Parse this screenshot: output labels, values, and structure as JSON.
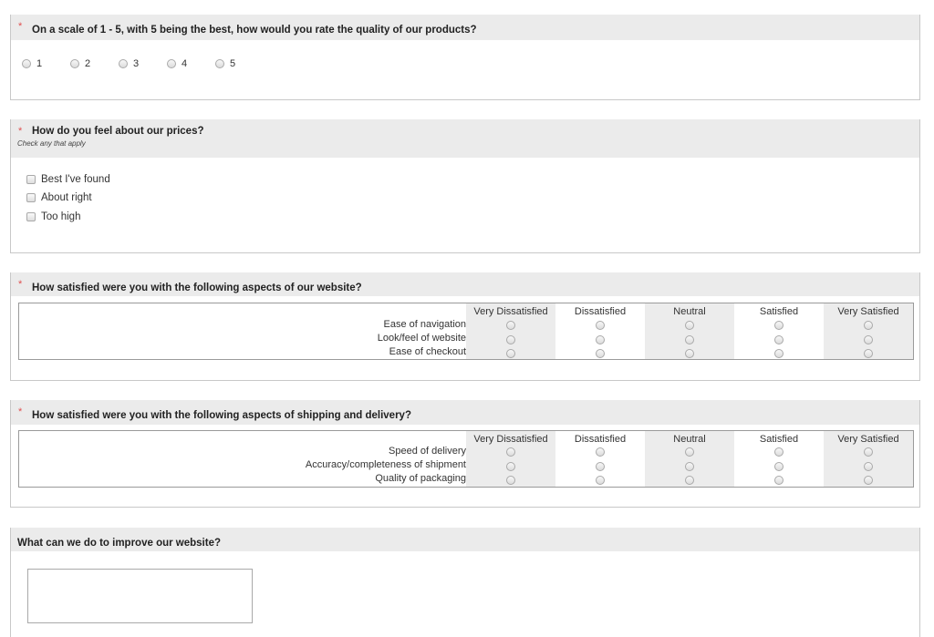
{
  "q1": {
    "required_mark": "*",
    "title": "On a scale of 1 - 5, with 5 being the best, how would you rate the quality of our products?",
    "options": [
      "1",
      "2",
      "3",
      "4",
      "5"
    ]
  },
  "q2": {
    "required_mark": "*",
    "title": "How do you feel about our prices?",
    "subtitle": "Check any that apply",
    "options": [
      "Best I've found",
      "About right",
      "Too high"
    ]
  },
  "q3": {
    "required_mark": "*",
    "title": "How satisfied were you with the following aspects of our website?",
    "columns": [
      "Very Dissatisfied",
      "Dissatisfied",
      "Neutral",
      "Satisfied",
      "Very Satisfied"
    ],
    "rows": [
      "Ease of navigation",
      "Look/feel of website",
      "Ease of checkout"
    ]
  },
  "q4": {
    "required_mark": "*",
    "title": "How satisfied were you with the following aspects of shipping and delivery?",
    "columns": [
      "Very Dissatisfied",
      "Dissatisfied",
      "Neutral",
      "Satisfied",
      "Very Satisfied"
    ],
    "rows": [
      "Speed of delivery",
      "Accuracy/completeness of shipment",
      "Quality of packaging"
    ]
  },
  "q5": {
    "title": "What can we do to improve our website?",
    "value": ""
  },
  "colors": {
    "header_bg": "#ebebeb",
    "required": "#e05050",
    "border": "#c8c8c8"
  }
}
